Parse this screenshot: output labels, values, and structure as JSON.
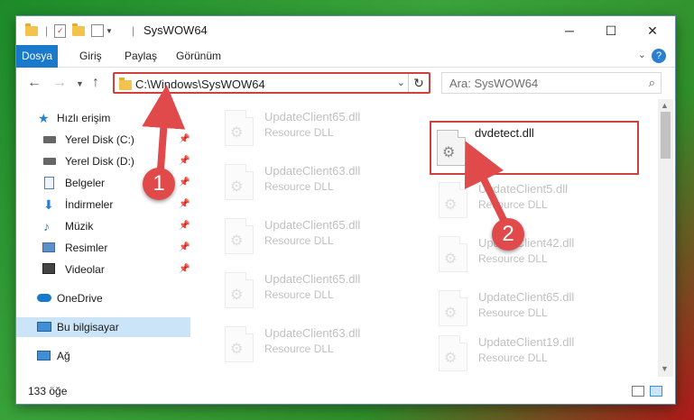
{
  "window": {
    "title": "SysWOW64"
  },
  "ribbon": {
    "tabs": [
      "Dosya",
      "Giriş",
      "Paylaş",
      "Görünüm"
    ]
  },
  "address": {
    "path": "C:\\Windows\\SysWOW64"
  },
  "search": {
    "placeholder": "Ara: SysWOW64"
  },
  "sidebar": {
    "quick_access": "Hızlı erişim",
    "items": [
      {
        "label": "Yerel Disk (C:)",
        "icon": "drive-icon"
      },
      {
        "label": "Yerel Disk (D:)",
        "icon": "drive-icon"
      },
      {
        "label": "Belgeler",
        "icon": "documents-icon"
      },
      {
        "label": "İndirmeler",
        "icon": "download-icon"
      },
      {
        "label": "Müzik",
        "icon": "music-icon"
      },
      {
        "label": "Resimler",
        "icon": "pictures-icon"
      },
      {
        "label": "Videolar",
        "icon": "videos-icon"
      }
    ],
    "onedrive": "OneDrive",
    "this_pc": "Bu bilgisayar",
    "network": "Ağ"
  },
  "files": {
    "type": "Resource DLL",
    "left_column": [
      "UpdateClient65.dll",
      "UpdateClient63.dll",
      "UpdateClient65.dll",
      "UpdateClient65.dll",
      "UpdateClient63.dll"
    ],
    "right_column": [
      "dvdetect.dll",
      "UpdateClient5.dll",
      "UpdateClient42.dll",
      "UpdateClient65.dll",
      "UpdateClient19.dll"
    ]
  },
  "status": {
    "item_count": "133 öğe"
  },
  "annotations": {
    "step1": "1",
    "step2": "2"
  },
  "colors": {
    "accent": "#1979ca",
    "highlight": "#d23f3f",
    "selected": "#cce4f7"
  }
}
